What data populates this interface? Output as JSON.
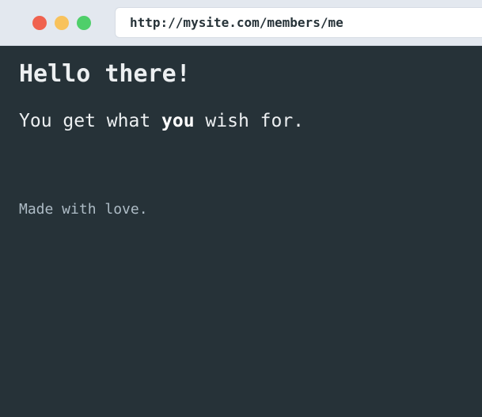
{
  "browser": {
    "url": "http://mysite.com/members/me",
    "buttons": {
      "close_color": "#f0624f",
      "minimize_color": "#f8c25c",
      "maximize_color": "#4fcf6a"
    }
  },
  "page": {
    "heading": "Hello there!",
    "message": {
      "before": "You get what ",
      "emphasis": "you",
      "after": " wish for."
    },
    "footer": "Made with love."
  }
}
